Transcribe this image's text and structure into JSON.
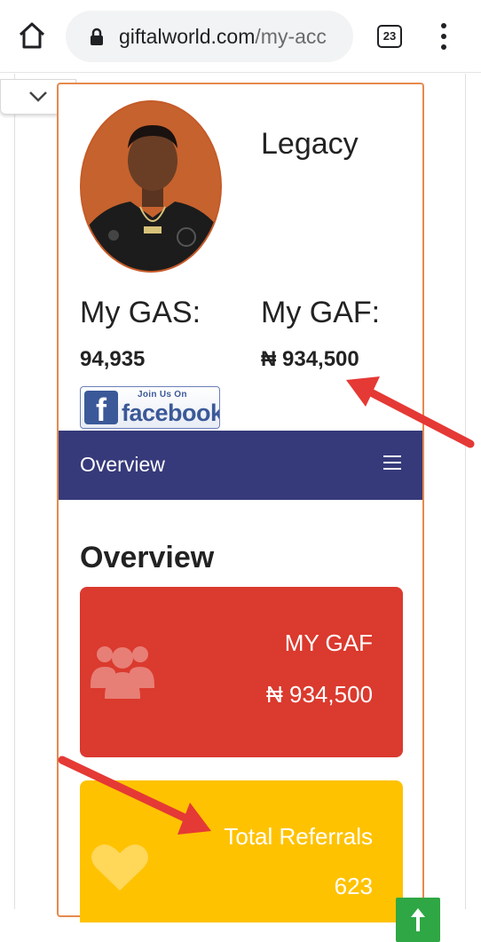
{
  "browser": {
    "url_host": "giftalworld.com",
    "url_path": "/my-acc",
    "tab_count": "23"
  },
  "profile": {
    "username": "Legacy",
    "gas_label": "My GAS:",
    "gas_value": "94,935",
    "gaf_label": "My GAF:",
    "gaf_value": "₦ 934,500"
  },
  "facebook_badge": {
    "top_text": "Join Us On",
    "brand_text": "facebook"
  },
  "navbar": {
    "title": "Overview"
  },
  "overview": {
    "heading": "Overview",
    "tiles": [
      {
        "label": "MY GAF",
        "value": "₦ 934,500",
        "icon": "users-icon",
        "color": "#db3a2e"
      },
      {
        "label": "Total Referrals",
        "value": "623",
        "icon": "heart-icon",
        "color": "#ffc200"
      }
    ]
  },
  "colors": {
    "accent_border": "#e58a4e",
    "navbar": "#363a7a",
    "scroll_button": "#2fa744",
    "annotation_arrow": "#e53935"
  }
}
